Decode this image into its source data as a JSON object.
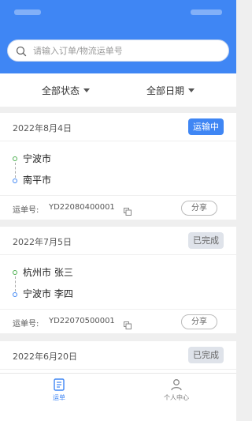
{
  "search": {
    "placeholder": "请输入订单/物流运单号"
  },
  "filters": {
    "status_label": "全部状态",
    "date_label": "全部日期"
  },
  "orders": [
    {
      "date": "2022年8月4日",
      "status": "运输中",
      "from": "宁波市",
      "to": "南平市",
      "waybill_label": "运单号:",
      "waybill_no": "YD22080400001",
      "share_label": "分享"
    },
    {
      "date": "2022年7月5日",
      "status": "已完成",
      "from": "杭州市 张三",
      "to": "宁波市 李四",
      "waybill_label": "运单号:",
      "waybill_no": "YD22070500001",
      "share_label": "分享"
    },
    {
      "date": "2022年6月20日",
      "status": "已完成"
    }
  ],
  "tabbar": {
    "orders_label": "运单",
    "profile_label": "个人中心"
  },
  "colors": {
    "primary": "#3f86f4",
    "background": "#efefef",
    "done_badge": "#dfe3ea"
  },
  "icons": {
    "search": "search-icon",
    "copy": "copy-icon",
    "orders_tab": "document-icon",
    "profile_tab": "person-icon"
  }
}
